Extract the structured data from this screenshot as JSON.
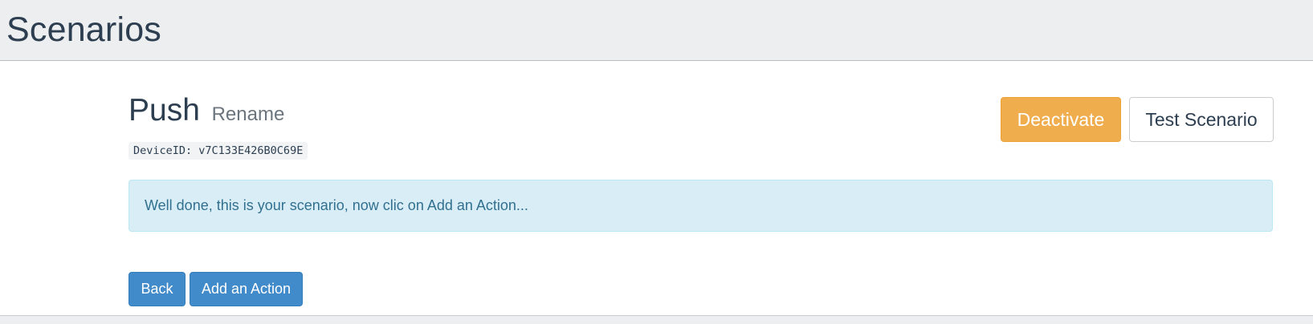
{
  "header": {
    "title": "Scenarios"
  },
  "scenario": {
    "name": "Push",
    "rename_label": "Rename",
    "device_id": "DeviceID: v7C133E426B0C69E"
  },
  "actions": {
    "deactivate_label": "Deactivate",
    "test_label": "Test Scenario"
  },
  "alert": {
    "message": "Well done, this is your scenario, now clic on Add an Action..."
  },
  "footer_buttons": {
    "back_label": "Back",
    "add_action_label": "Add an Action"
  },
  "colors": {
    "warning": "#f0ad4e",
    "primary": "#428bca",
    "info_bg": "#d9edf7",
    "info_text": "#31708f",
    "header_bg": "#eceeef"
  }
}
